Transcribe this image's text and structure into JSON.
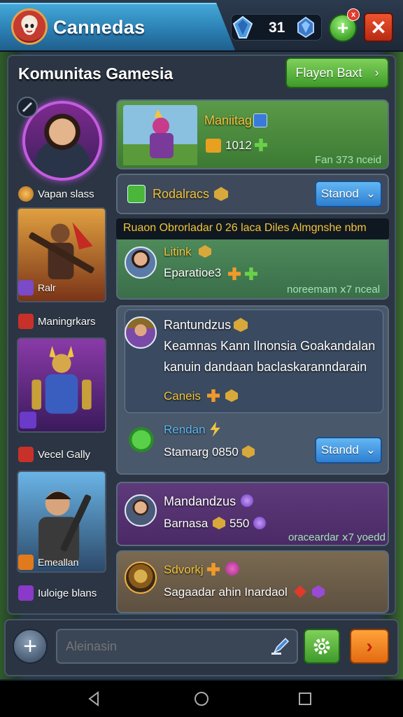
{
  "header": {
    "app_title": "Cannedas",
    "currency_count": "31",
    "notification_badge": "x",
    "add_label": "+",
    "close_label": "✕"
  },
  "page": {
    "title": "Komunitas Gamesia",
    "player_button": "Flayen Baxt",
    "player_button_chevron": "›"
  },
  "sidebar": {
    "labels": [
      "Vapan slass",
      "Ralr",
      "Maningrkars",
      "Vecel Gally",
      "Emeallan",
      "Iuloige blans"
    ]
  },
  "cards": {
    "top": {
      "name": "Maniitag",
      "score": "1012",
      "footer": "Fan 373 nceid"
    },
    "stand1": {
      "label": "Rodalracs",
      "button": "Stanod",
      "chevron": "⌄"
    },
    "banner": "Ruaon Obrorladar  0 26 laca Diles Almgnshe nbm",
    "link": {
      "name": "Litink",
      "sub": "Eparatioe3",
      "footer": "noreemam ⅹ7 nceal"
    },
    "post": {
      "author": "Rantundzus",
      "line1": "Keamnas Kann Ilnonsia Goakandalan",
      "line2": "kanuin dandaan baclaskaranndarain",
      "tag": "Caneis"
    },
    "reply": {
      "name": "Rendan",
      "sub": "Stamarg 0850",
      "button": "Standd",
      "chevron": "⌄"
    },
    "purple": {
      "name": "Mandandzus",
      "sub": "Barnasa",
      "value": "550",
      "footer": "oraceardar ⅹ7 yoedd"
    },
    "last": {
      "name": "Sdvorkj",
      "sub": "Sagaadar ahin Inardaol"
    }
  },
  "chat": {
    "placeholder": "Aleinasin",
    "plus_label": "+",
    "send_label": "›"
  },
  "colors": {
    "accent_blue": "#2e7fd1",
    "accent_green": "#3e9a2a",
    "accent_orange": "#e46a12",
    "close_red": "#b52a14",
    "gold_text": "#f2c43a"
  }
}
